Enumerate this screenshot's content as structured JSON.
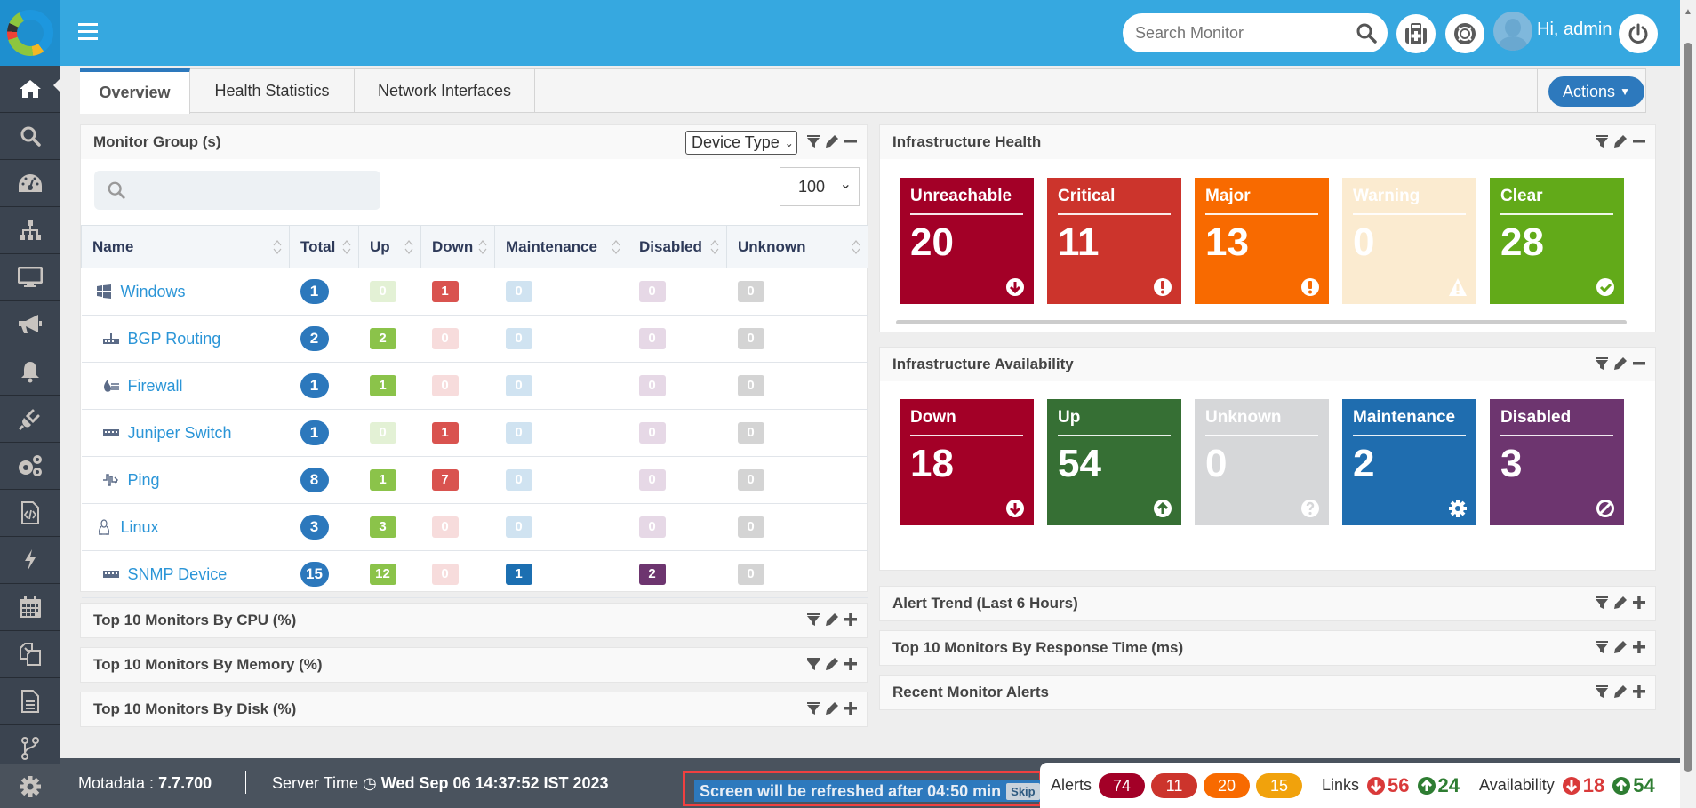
{
  "header": {
    "menu_icon": "hamburger-icon",
    "search_placeholder": "Search Monitor",
    "greeting": "Hi, admin",
    "buttons": [
      "medkit-icon",
      "lifebuoy-icon",
      "power-icon"
    ]
  },
  "sidebar": {
    "items": [
      "home",
      "search",
      "dashboard",
      "topology",
      "monitor",
      "announcement",
      "alerts",
      "plugins",
      "settings-gears",
      "script",
      "action",
      "calendar",
      "copy",
      "report",
      "branch"
    ],
    "bottom": "settings"
  },
  "tabs": [
    "Overview",
    "Health Statistics",
    "Network Interfaces"
  ],
  "actions_label": "Actions",
  "monitor_group": {
    "title": "Monitor Group (s)",
    "filter_select": "Device Type",
    "page_size": "100",
    "search_placeholder": "",
    "columns": [
      "Name",
      "Total",
      "Up",
      "Down",
      "Maintenance",
      "Disabled",
      "Unknown"
    ],
    "rows": [
      {
        "name": "Windows",
        "icon": "windows-icon",
        "total": "1",
        "up": "0",
        "down": "1",
        "maintenance": "0",
        "disabled": "0",
        "unknown": "0"
      },
      {
        "name": "BGP Routing",
        "icon": "router-icon",
        "total": "2",
        "up": "2",
        "down": "0",
        "maintenance": "0",
        "disabled": "0",
        "unknown": "0"
      },
      {
        "name": "Firewall",
        "icon": "firewall-icon",
        "total": "1",
        "up": "1",
        "down": "0",
        "maintenance": "0",
        "disabled": "0",
        "unknown": "0"
      },
      {
        "name": "Juniper Switch",
        "icon": "switch-icon",
        "total": "1",
        "up": "0",
        "down": "1",
        "maintenance": "0",
        "disabled": "0",
        "unknown": "0"
      },
      {
        "name": "Ping",
        "icon": "ping-icon",
        "total": "8",
        "up": "1",
        "down": "7",
        "maintenance": "0",
        "disabled": "0",
        "unknown": "0"
      },
      {
        "name": "Linux",
        "icon": "linux-icon",
        "total": "3",
        "up": "3",
        "down": "0",
        "maintenance": "0",
        "disabled": "0",
        "unknown": "0"
      },
      {
        "name": "SNMP Device",
        "icon": "switch-icon",
        "total": "15",
        "up": "12",
        "down": "0",
        "maintenance": "1",
        "disabled": "2",
        "unknown": "0"
      }
    ]
  },
  "left_collapsed": [
    "Top 10 Monitors By CPU (%)",
    "Top 10 Monitors By Memory (%)",
    "Top 10 Monitors By Disk (%)"
  ],
  "infra_health": {
    "title": "Infrastructure Health",
    "tiles": [
      {
        "label": "Unreachable",
        "value": "20",
        "color": "#a30027",
        "icon": "arrow-down-circle-icon"
      },
      {
        "label": "Critical",
        "value": "11",
        "color": "#cc342c",
        "icon": "exclamation-circle-icon"
      },
      {
        "label": "Major",
        "value": "13",
        "color": "#f86a00",
        "icon": "exclamation-circle-icon"
      },
      {
        "label": "Warning",
        "value": "0",
        "color": "#fbebd0",
        "icon": "warning-triangle-icon"
      },
      {
        "label": "Clear",
        "value": "28",
        "color": "#62aa19",
        "icon": "check-circle-icon"
      }
    ]
  },
  "infra_availability": {
    "title": "Infrastructure Availability",
    "tiles": [
      {
        "label": "Down",
        "value": "18",
        "color": "#a30027",
        "icon": "arrow-down-circle-icon"
      },
      {
        "label": "Up",
        "value": "54",
        "color": "#366f34",
        "icon": "arrow-up-circle-icon"
      },
      {
        "label": "Unknown",
        "value": "0",
        "color": "#d6d7d9",
        "icon": "question-circle-icon"
      },
      {
        "label": "Maintenance",
        "value": "2",
        "color": "#1f6daf",
        "icon": "gear-icon"
      },
      {
        "label": "Disabled",
        "value": "3",
        "color": "#6d356f",
        "icon": "ban-icon"
      }
    ]
  },
  "right_collapsed": [
    "Alert Trend (Last 6 Hours)",
    "Top 10 Monitors By Response Time (ms)",
    "Recent Monitor Alerts"
  ],
  "footer": {
    "product": "Motadata : ",
    "version": "7.7.700",
    "server_time_label": "Server Time ",
    "server_time": "Wed Sep 06 14:37:52 IST 2023",
    "refresh_text": "Screen will be refreshed after 04:50 min",
    "skip_label": "Skip",
    "alerts_label": "Alerts",
    "alerts": [
      {
        "value": "74",
        "color": "#a30027"
      },
      {
        "value": "11",
        "color": "#cc342c"
      },
      {
        "value": "20",
        "color": "#f86a00"
      },
      {
        "value": "15",
        "color": "#f1a20c"
      }
    ],
    "links_label": "Links",
    "links_down": "56",
    "links_up": "24",
    "availability_label": "Availability",
    "availability_down": "18",
    "availability_up": "54"
  },
  "colors": {
    "accent": "#36a8e0",
    "primary": "#2d79bd",
    "down": "#d93a3a",
    "up": "#2e7d32"
  }
}
